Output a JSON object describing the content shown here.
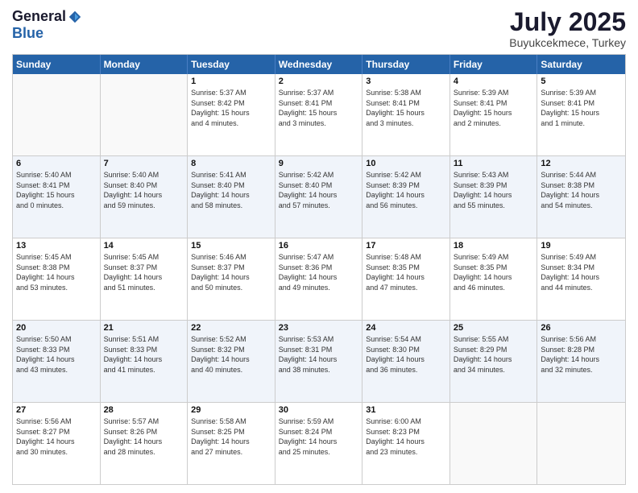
{
  "header": {
    "logo_general": "General",
    "logo_blue": "Blue",
    "month_title": "July 2025",
    "location": "Buyukcekmece, Turkey"
  },
  "weekdays": [
    "Sunday",
    "Monday",
    "Tuesday",
    "Wednesday",
    "Thursday",
    "Friday",
    "Saturday"
  ],
  "rows": [
    [
      {
        "day": "",
        "info": ""
      },
      {
        "day": "",
        "info": ""
      },
      {
        "day": "1",
        "info": "Sunrise: 5:37 AM\nSunset: 8:42 PM\nDaylight: 15 hours\nand 4 minutes."
      },
      {
        "day": "2",
        "info": "Sunrise: 5:37 AM\nSunset: 8:41 PM\nDaylight: 15 hours\nand 3 minutes."
      },
      {
        "day": "3",
        "info": "Sunrise: 5:38 AM\nSunset: 8:41 PM\nDaylight: 15 hours\nand 3 minutes."
      },
      {
        "day": "4",
        "info": "Sunrise: 5:39 AM\nSunset: 8:41 PM\nDaylight: 15 hours\nand 2 minutes."
      },
      {
        "day": "5",
        "info": "Sunrise: 5:39 AM\nSunset: 8:41 PM\nDaylight: 15 hours\nand 1 minute."
      }
    ],
    [
      {
        "day": "6",
        "info": "Sunrise: 5:40 AM\nSunset: 8:41 PM\nDaylight: 15 hours\nand 0 minutes."
      },
      {
        "day": "7",
        "info": "Sunrise: 5:40 AM\nSunset: 8:40 PM\nDaylight: 14 hours\nand 59 minutes."
      },
      {
        "day": "8",
        "info": "Sunrise: 5:41 AM\nSunset: 8:40 PM\nDaylight: 14 hours\nand 58 minutes."
      },
      {
        "day": "9",
        "info": "Sunrise: 5:42 AM\nSunset: 8:40 PM\nDaylight: 14 hours\nand 57 minutes."
      },
      {
        "day": "10",
        "info": "Sunrise: 5:42 AM\nSunset: 8:39 PM\nDaylight: 14 hours\nand 56 minutes."
      },
      {
        "day": "11",
        "info": "Sunrise: 5:43 AM\nSunset: 8:39 PM\nDaylight: 14 hours\nand 55 minutes."
      },
      {
        "day": "12",
        "info": "Sunrise: 5:44 AM\nSunset: 8:38 PM\nDaylight: 14 hours\nand 54 minutes."
      }
    ],
    [
      {
        "day": "13",
        "info": "Sunrise: 5:45 AM\nSunset: 8:38 PM\nDaylight: 14 hours\nand 53 minutes."
      },
      {
        "day": "14",
        "info": "Sunrise: 5:45 AM\nSunset: 8:37 PM\nDaylight: 14 hours\nand 51 minutes."
      },
      {
        "day": "15",
        "info": "Sunrise: 5:46 AM\nSunset: 8:37 PM\nDaylight: 14 hours\nand 50 minutes."
      },
      {
        "day": "16",
        "info": "Sunrise: 5:47 AM\nSunset: 8:36 PM\nDaylight: 14 hours\nand 49 minutes."
      },
      {
        "day": "17",
        "info": "Sunrise: 5:48 AM\nSunset: 8:35 PM\nDaylight: 14 hours\nand 47 minutes."
      },
      {
        "day": "18",
        "info": "Sunrise: 5:49 AM\nSunset: 8:35 PM\nDaylight: 14 hours\nand 46 minutes."
      },
      {
        "day": "19",
        "info": "Sunrise: 5:49 AM\nSunset: 8:34 PM\nDaylight: 14 hours\nand 44 minutes."
      }
    ],
    [
      {
        "day": "20",
        "info": "Sunrise: 5:50 AM\nSunset: 8:33 PM\nDaylight: 14 hours\nand 43 minutes."
      },
      {
        "day": "21",
        "info": "Sunrise: 5:51 AM\nSunset: 8:33 PM\nDaylight: 14 hours\nand 41 minutes."
      },
      {
        "day": "22",
        "info": "Sunrise: 5:52 AM\nSunset: 8:32 PM\nDaylight: 14 hours\nand 40 minutes."
      },
      {
        "day": "23",
        "info": "Sunrise: 5:53 AM\nSunset: 8:31 PM\nDaylight: 14 hours\nand 38 minutes."
      },
      {
        "day": "24",
        "info": "Sunrise: 5:54 AM\nSunset: 8:30 PM\nDaylight: 14 hours\nand 36 minutes."
      },
      {
        "day": "25",
        "info": "Sunrise: 5:55 AM\nSunset: 8:29 PM\nDaylight: 14 hours\nand 34 minutes."
      },
      {
        "day": "26",
        "info": "Sunrise: 5:56 AM\nSunset: 8:28 PM\nDaylight: 14 hours\nand 32 minutes."
      }
    ],
    [
      {
        "day": "27",
        "info": "Sunrise: 5:56 AM\nSunset: 8:27 PM\nDaylight: 14 hours\nand 30 minutes."
      },
      {
        "day": "28",
        "info": "Sunrise: 5:57 AM\nSunset: 8:26 PM\nDaylight: 14 hours\nand 28 minutes."
      },
      {
        "day": "29",
        "info": "Sunrise: 5:58 AM\nSunset: 8:25 PM\nDaylight: 14 hours\nand 27 minutes."
      },
      {
        "day": "30",
        "info": "Sunrise: 5:59 AM\nSunset: 8:24 PM\nDaylight: 14 hours\nand 25 minutes."
      },
      {
        "day": "31",
        "info": "Sunrise: 6:00 AM\nSunset: 8:23 PM\nDaylight: 14 hours\nand 23 minutes."
      },
      {
        "day": "",
        "info": ""
      },
      {
        "day": "",
        "info": ""
      }
    ]
  ]
}
